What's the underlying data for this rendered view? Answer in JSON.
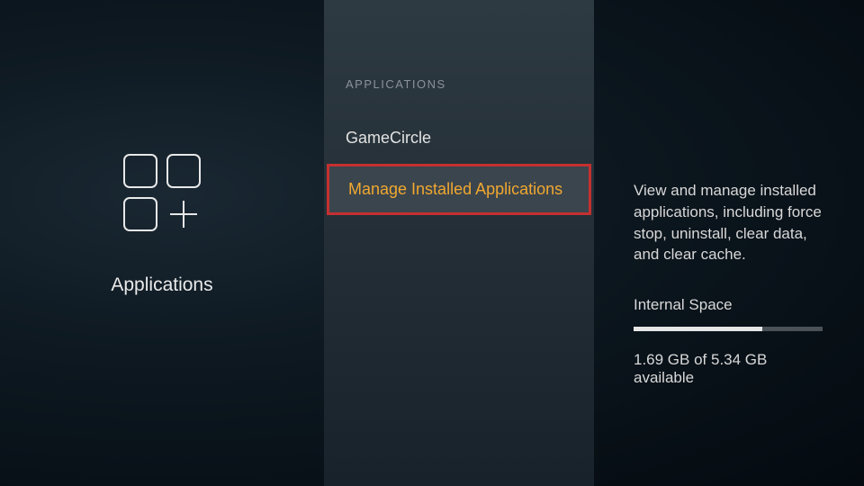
{
  "left": {
    "title": "Applications"
  },
  "mid": {
    "header": "APPLICATIONS",
    "items": [
      {
        "label": "GameCircle"
      },
      {
        "label": "Manage Installed Applications"
      }
    ]
  },
  "right": {
    "description": "View and manage installed applications, including force stop, uninstall, clear data, and clear cache.",
    "space_label": "Internal Space",
    "space_text": "1.69 GB of 5.34 GB available",
    "space_used_pct": 68
  }
}
